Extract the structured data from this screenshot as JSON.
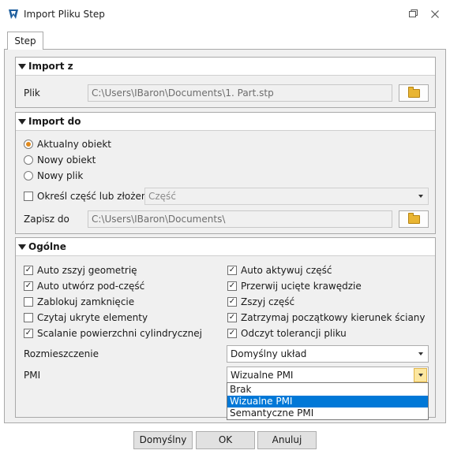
{
  "window": {
    "title": "Import Pliku Step",
    "tab": "Step"
  },
  "sections": {
    "import_from": {
      "title": "Import z",
      "file_label": "Plik",
      "file_value": "C:\\Users\\IBaron\\Documents\\1. Part.stp"
    },
    "import_to": {
      "title": "Import do",
      "radios": [
        "Aktualny obiekt",
        "Nowy obiekt",
        "Nowy plik"
      ],
      "selected_radio": "Aktualny obiekt",
      "specify_label": "Określ część lub złożenie",
      "specify_checked": false,
      "part_select_value": "Część",
      "save_label": "Zapisz do",
      "save_value": "C:\\Users\\IBaron\\Documents\\"
    },
    "general": {
      "title": "Ogólne",
      "left_options": [
        {
          "label": "Auto zszyj geometrię",
          "checked": true
        },
        {
          "label": "Auto utwórz pod-część",
          "checked": true
        },
        {
          "label": "Zablokuj zamknięcie",
          "checked": false
        },
        {
          "label": "Czytaj ukryte elementy",
          "checked": false
        },
        {
          "label": "Scalanie powierzchni cylindrycznej",
          "checked": true
        }
      ],
      "right_options": [
        {
          "label": "Auto aktywuj część",
          "checked": true
        },
        {
          "label": "Przerwij ucięte krawędzie",
          "checked": true
        },
        {
          "label": "Zszyj część",
          "checked": true
        },
        {
          "label": "Zatrzymaj początkowy kierunek ściany",
          "checked": true
        },
        {
          "label": "Odczyt tolerancji pliku",
          "checked": true
        }
      ],
      "placement_label": "Rozmieszczenie",
      "placement_value": "Domyślny układ",
      "pmi_label": "PMI",
      "pmi_value": "Wizualne PMI",
      "pmi_options": [
        "Brak",
        "Wizualne PMI",
        "Semantyczne PMI"
      ]
    }
  },
  "buttons": {
    "defaults": "Domyślny",
    "ok": "OK",
    "cancel": "Anuluj"
  },
  "colors": {
    "selection": "#0078d7",
    "radio_accent": "#e08a1e",
    "folder": "#e9b532"
  }
}
